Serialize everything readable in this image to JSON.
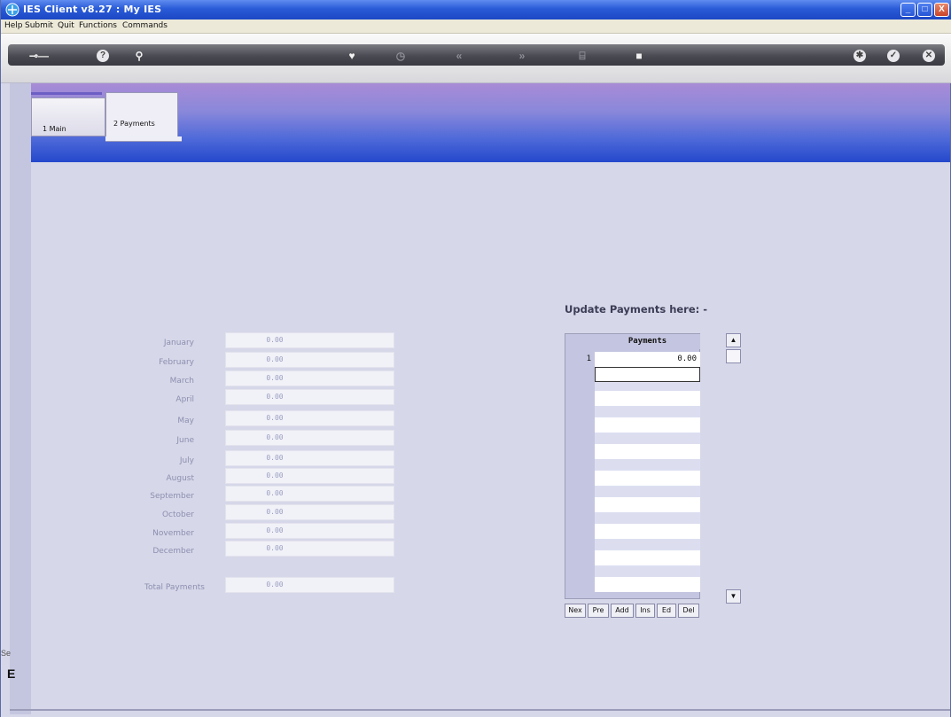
{
  "window": {
    "title": "IES Client v8.27 : My IES",
    "minimize": "_",
    "maximize": "□",
    "close": "X"
  },
  "menu": [
    "Help",
    "Submit",
    "Quit",
    "Functions",
    "Commands"
  ],
  "tabs": [
    {
      "label": "1 Main"
    },
    {
      "label": "2 Payments"
    }
  ],
  "months": [
    {
      "label": "January",
      "value": "0.00"
    },
    {
      "label": "February",
      "value": "0.00"
    },
    {
      "label": "March",
      "value": "0.00"
    },
    {
      "label": "April",
      "value": "0.00"
    },
    {
      "label": "May",
      "value": "0.00"
    },
    {
      "label": "June",
      "value": "0.00"
    },
    {
      "label": "July",
      "value": "0.00"
    },
    {
      "label": "August",
      "value": "0.00"
    },
    {
      "label": "September",
      "value": "0.00"
    },
    {
      "label": "October",
      "value": "0.00"
    },
    {
      "label": "November",
      "value": "0.00"
    },
    {
      "label": "December",
      "value": "0.00"
    }
  ],
  "total": {
    "label": "Total Payments",
    "value": "0.00"
  },
  "payments": {
    "heading": "Update Payments here: -",
    "column": "Payments",
    "rows": [
      {
        "num": "1",
        "value": "0.00"
      }
    ]
  },
  "grid_buttons": [
    "Nex",
    "Pre",
    "Add",
    "Ins",
    "Ed",
    "Del"
  ],
  "side": {
    "label": "Se",
    "glyph": "E"
  }
}
